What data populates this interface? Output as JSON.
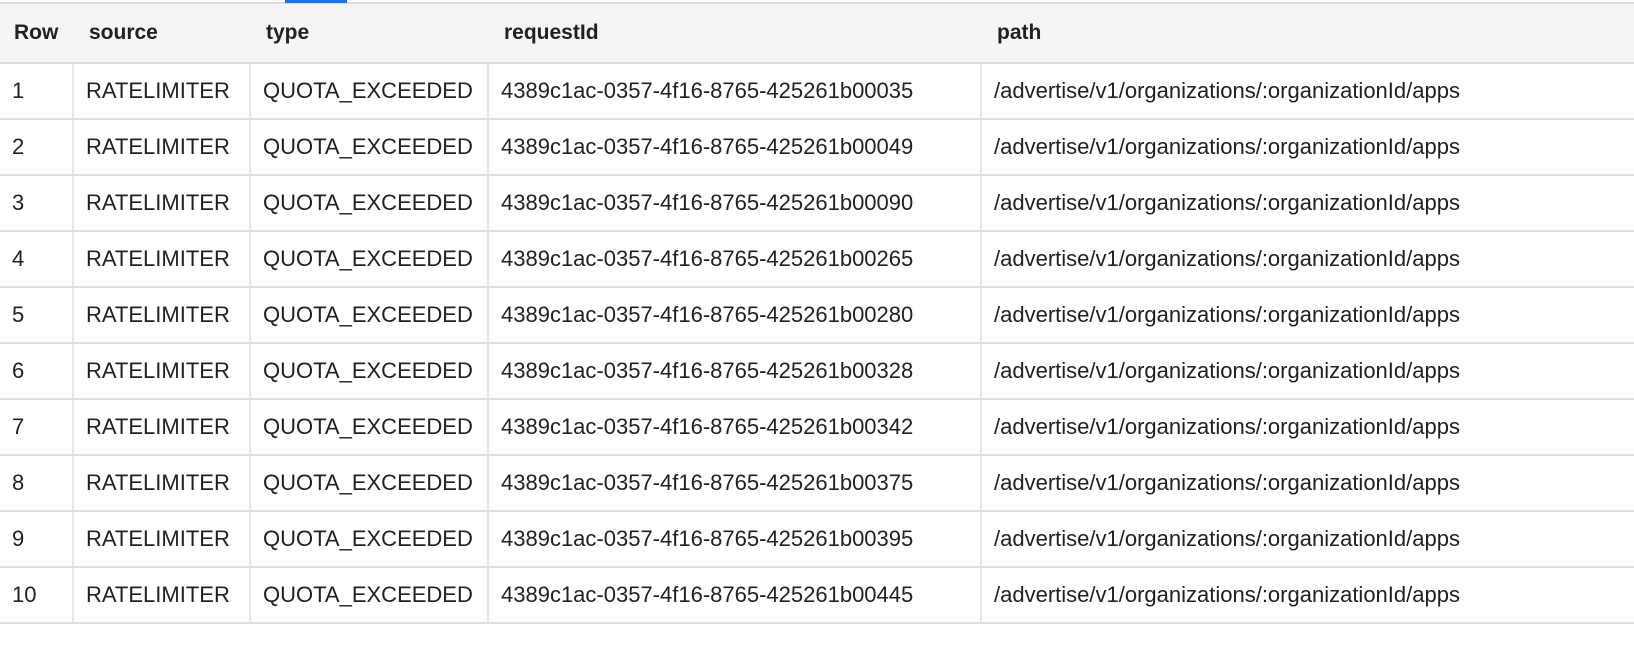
{
  "table": {
    "columns": [
      "Row",
      "source",
      "type",
      "requestId",
      "path"
    ],
    "rows": [
      [
        "1",
        "RATELIMITER",
        "QUOTA_EXCEEDED",
        "4389c1ac-0357-4f16-8765-425261b00035",
        "/advertise/v1/organizations/:organizationId/apps"
      ],
      [
        "2",
        "RATELIMITER",
        "QUOTA_EXCEEDED",
        "4389c1ac-0357-4f16-8765-425261b00049",
        "/advertise/v1/organizations/:organizationId/apps"
      ],
      [
        "3",
        "RATELIMITER",
        "QUOTA_EXCEEDED",
        "4389c1ac-0357-4f16-8765-425261b00090",
        "/advertise/v1/organizations/:organizationId/apps"
      ],
      [
        "4",
        "RATELIMITER",
        "QUOTA_EXCEEDED",
        "4389c1ac-0357-4f16-8765-425261b00265",
        "/advertise/v1/organizations/:organizationId/apps"
      ],
      [
        "5",
        "RATELIMITER",
        "QUOTA_EXCEEDED",
        "4389c1ac-0357-4f16-8765-425261b00280",
        "/advertise/v1/organizations/:organizationId/apps"
      ],
      [
        "6",
        "RATELIMITER",
        "QUOTA_EXCEEDED",
        "4389c1ac-0357-4f16-8765-425261b00328",
        "/advertise/v1/organizations/:organizationId/apps"
      ],
      [
        "7",
        "RATELIMITER",
        "QUOTA_EXCEEDED",
        "4389c1ac-0357-4f16-8765-425261b00342",
        "/advertise/v1/organizations/:organizationId/apps"
      ],
      [
        "8",
        "RATELIMITER",
        "QUOTA_EXCEEDED",
        "4389c1ac-0357-4f16-8765-425261b00375",
        "/advertise/v1/organizations/:organizationId/apps"
      ],
      [
        "9",
        "RATELIMITER",
        "QUOTA_EXCEEDED",
        "4389c1ac-0357-4f16-8765-425261b00395",
        "/advertise/v1/organizations/:organizationId/apps"
      ],
      [
        "10",
        "RATELIMITER",
        "QUOTA_EXCEEDED",
        "4389c1ac-0357-4f16-8765-425261b00445",
        "/advertise/v1/organizations/:organizationId/apps"
      ]
    ]
  }
}
